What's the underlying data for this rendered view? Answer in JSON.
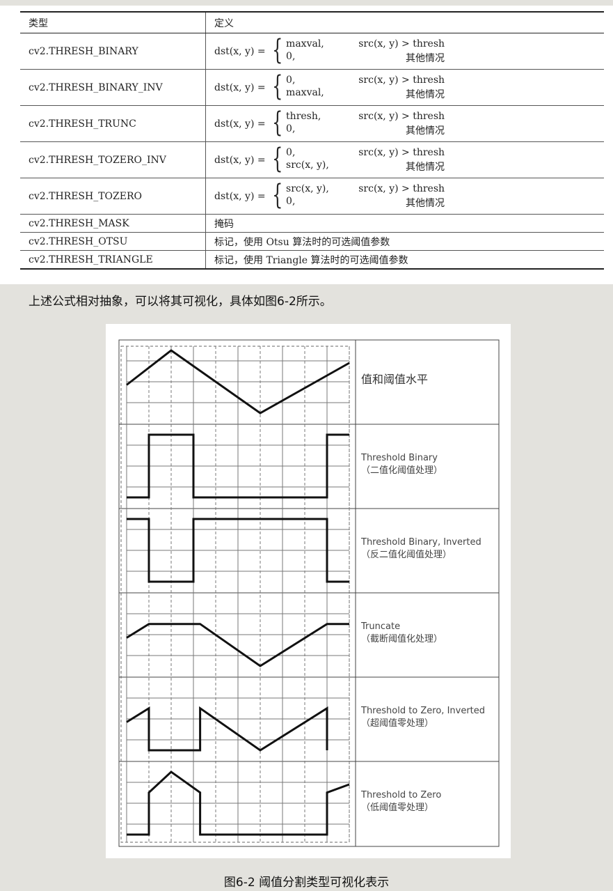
{
  "table": {
    "headers": [
      "类型",
      "定义"
    ],
    "rows": [
      {
        "type": "cv2.THRESH_BINARY",
        "lhs": "dst(x, y) =",
        "cases": [
          [
            "maxval,",
            "src(x, y) > thresh"
          ],
          [
            "0,",
            "其他情况"
          ]
        ]
      },
      {
        "type": "cv2.THRESH_BINARY_INV",
        "lhs": "dst(x, y) =",
        "cases": [
          [
            "0,",
            "src(x, y) > thresh"
          ],
          [
            "maxval,",
            "其他情况"
          ]
        ]
      },
      {
        "type": "cv2.THRESH_TRUNC",
        "lhs": "dst(x, y) =",
        "cases": [
          [
            "thresh,",
            "src(x, y) > thresh"
          ],
          [
            "0,",
            "其他情况"
          ]
        ]
      },
      {
        "type": "cv2.THRESH_TOZERO_INV",
        "lhs": "dst(x, y) =",
        "cases": [
          [
            "0,",
            "src(x, y) > thresh"
          ],
          [
            "src(x, y),",
            "其他情况"
          ]
        ]
      },
      {
        "type": "cv2.THRESH_TOZERO",
        "lhs": "dst(x, y) =",
        "cases": [
          [
            "src(x, y),",
            "src(x, y) > thresh"
          ],
          [
            "0,",
            "其他情况"
          ]
        ]
      },
      {
        "type": "cv2.THRESH_MASK",
        "definition": "掩码"
      },
      {
        "type": "cv2.THRESH_OTSU",
        "definition": "标记，使用 Otsu 算法时的可选阈值参数"
      },
      {
        "type": "cv2.THRESH_TRIANGLE",
        "definition": "标记，使用 Triangle 算法时的可选阈值参数"
      }
    ]
  },
  "paragraph": "上述公式相对抽象，可以将其可视化，具体如图6-2所示。",
  "figure": {
    "panels": [
      {
        "label_en": "",
        "label_cn": "值和阈值水平"
      },
      {
        "label_en": "Threshold Binary",
        "label_cn": "（二值化阈值处理）"
      },
      {
        "label_en": "Threshold Binary, Inverted",
        "label_cn": "（反二值化阈值处理）"
      },
      {
        "label_en": "Truncate",
        "label_cn": "（截断阈值化处理）"
      },
      {
        "label_en": "Threshold to Zero, Inverted",
        "label_cn": "（超阈值零处理）"
      },
      {
        "label_en": "Threshold to Zero",
        "label_cn": "（低阈值零处理）"
      }
    ],
    "caption": "图6-2 阈值分割类型可视化表示"
  },
  "colors": {
    "page_bg": "#e3e2dd",
    "card_bg": "#ffffff",
    "ink": "#111111",
    "grid": "#555555"
  }
}
